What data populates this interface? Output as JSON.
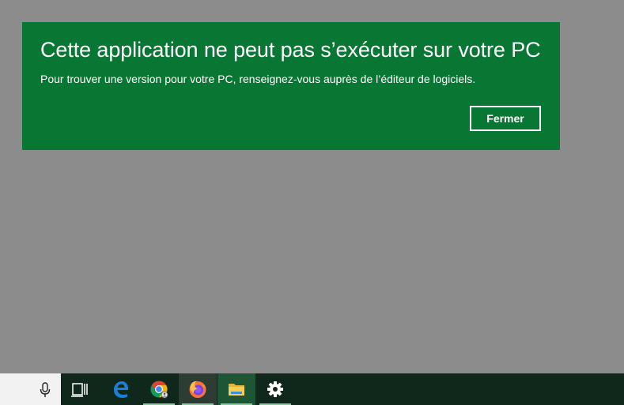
{
  "dialog": {
    "title": "Cette application ne peut pas s’exécuter sur votre PC",
    "message": "Pour trouver une version pour votre PC, renseignez-vous auprès de l’éditeur de logiciels.",
    "close_label": "Fermer",
    "background": "#077733"
  },
  "taskbar": {
    "icons": [
      "microphone-icon",
      "task-view-icon",
      "edge-icon",
      "chrome-icon",
      "firefox-icon",
      "file-explorer-icon",
      "settings-icon"
    ],
    "background": "#10281b",
    "running_indicator": "#8bc79f"
  }
}
